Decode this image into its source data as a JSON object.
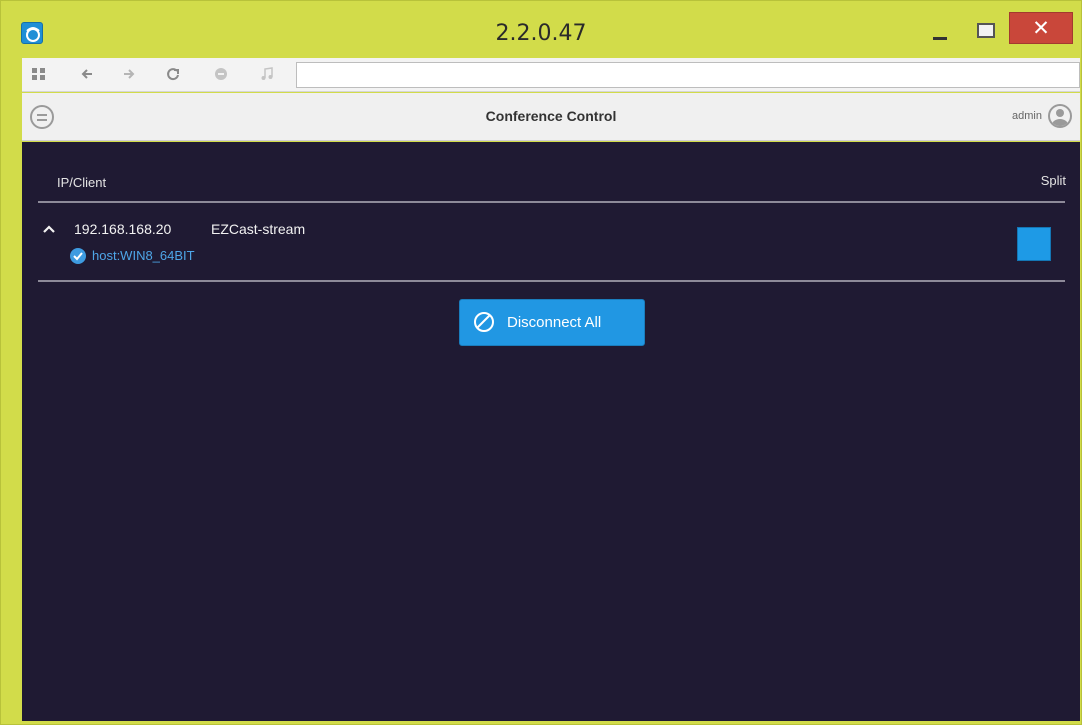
{
  "window": {
    "title": "2.2.0.47",
    "close_glyph": "✕",
    "accent_color": "#d2dc4a"
  },
  "toolbar": {
    "icons": [
      "apps-icon",
      "back-icon",
      "forward-icon",
      "reload-icon",
      "stop-icon",
      "music-icon"
    ],
    "address_value": ""
  },
  "header": {
    "title": "Conference Control",
    "user": "admin"
  },
  "table": {
    "col_left": "IP/Client",
    "col_right": "Split",
    "rows": [
      {
        "ip": "192.168.168.20",
        "name": "EZCast-stream",
        "host": "host:WIN8_64BIT",
        "split_checked": true
      }
    ]
  },
  "actions": {
    "disconnect_all": "Disconnect All"
  },
  "colors": {
    "content_bg": "#1f1a33",
    "button_blue": "#2197e3",
    "link_blue": "#4ea6e8"
  }
}
